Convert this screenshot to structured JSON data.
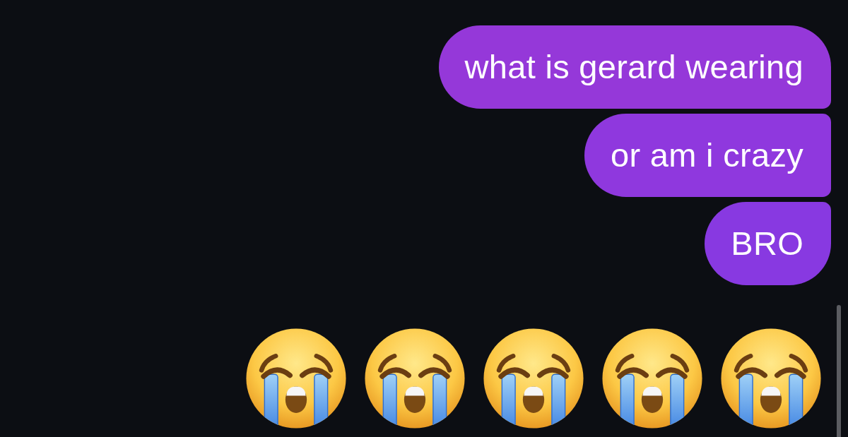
{
  "messages": [
    {
      "kind": "text",
      "text": "what is gerard wearing"
    },
    {
      "kind": "text",
      "text": "or am i crazy"
    },
    {
      "kind": "text",
      "text": "BRO"
    },
    {
      "kind": "emoji",
      "emojis": [
        {
          "kind": "crying"
        },
        {
          "kind": "crying"
        },
        {
          "kind": "crying"
        },
        {
          "kind": "crying"
        },
        {
          "kind": "crying"
        }
      ]
    }
  ]
}
